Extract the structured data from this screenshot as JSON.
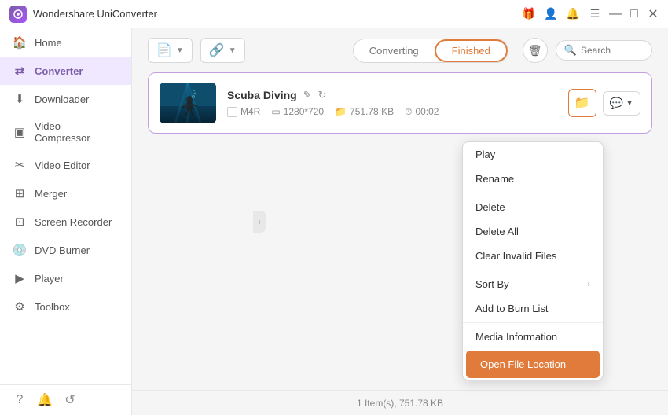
{
  "app": {
    "title": "Wondershare UniConverter",
    "logo_color": "#7b5ea7"
  },
  "titlebar": {
    "title": "Wondershare UniConverter",
    "controls": [
      "gift-icon",
      "user-icon",
      "bell-icon",
      "menu-icon",
      "minimize-icon",
      "maximize-icon",
      "close-icon"
    ]
  },
  "sidebar": {
    "items": [
      {
        "id": "home",
        "label": "Home",
        "icon": "🏠"
      },
      {
        "id": "converter",
        "label": "Converter",
        "icon": "⇄",
        "active": true
      },
      {
        "id": "downloader",
        "label": "Downloader",
        "icon": "↓"
      },
      {
        "id": "video-compressor",
        "label": "Video Compressor",
        "icon": "▣"
      },
      {
        "id": "video-editor",
        "label": "Video Editor",
        "icon": "✂"
      },
      {
        "id": "merger",
        "label": "Merger",
        "icon": "⊞"
      },
      {
        "id": "screen-recorder",
        "label": "Screen Recorder",
        "icon": "⊡"
      },
      {
        "id": "dvd-burner",
        "label": "DVD Burner",
        "icon": "💿"
      },
      {
        "id": "player",
        "label": "Player",
        "icon": "▶"
      },
      {
        "id": "toolbox",
        "label": "Toolbox",
        "icon": "⚙"
      }
    ],
    "bottom_icons": [
      "help-icon",
      "notification-icon",
      "feedback-icon"
    ]
  },
  "toolbar": {
    "add_file_label": "＋",
    "add_file_dropdown": true,
    "add_url_label": "＋",
    "tabs": {
      "converting_label": "Converting",
      "finished_label": "Finished",
      "active": "finished"
    },
    "delete_icon": "🗑",
    "search_placeholder": "Search"
  },
  "file_item": {
    "title": "Scuba Diving",
    "format": "M4R",
    "resolution": "1280*720",
    "size": "751.78 KB",
    "duration": "00:02"
  },
  "context_menu": {
    "items": [
      {
        "id": "play",
        "label": "Play",
        "has_submenu": false
      },
      {
        "id": "rename",
        "label": "Rename",
        "has_submenu": false
      },
      {
        "id": "delete",
        "label": "Delete",
        "has_submenu": false
      },
      {
        "id": "delete-all",
        "label": "Delete All",
        "has_submenu": false
      },
      {
        "id": "clear-invalid",
        "label": "Clear Invalid Files",
        "has_submenu": false
      },
      {
        "id": "sort-by",
        "label": "Sort By",
        "has_submenu": true
      },
      {
        "id": "add-to-burn",
        "label": "Add to Burn List",
        "has_submenu": false
      },
      {
        "id": "media-info",
        "label": "Media Information",
        "has_submenu": false
      },
      {
        "id": "open-file-location",
        "label": "Open File Location",
        "has_submenu": false,
        "highlighted": true
      }
    ]
  },
  "status_bar": {
    "text": "1 Item(s), 751.78 KB"
  }
}
